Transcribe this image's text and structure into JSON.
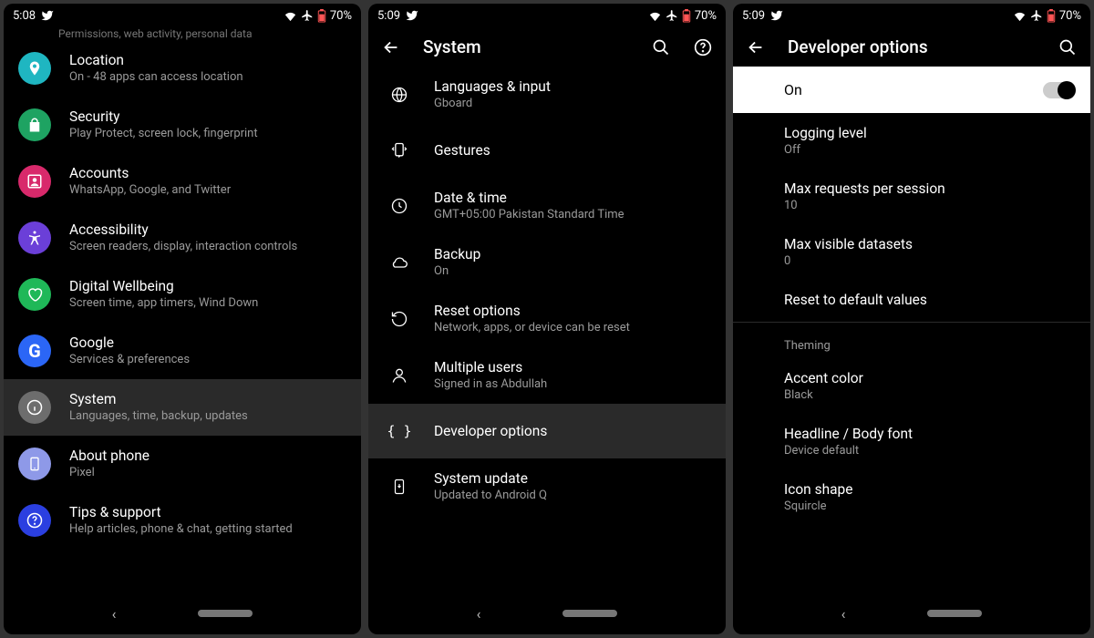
{
  "status": {
    "time1": "5:08",
    "time2": "5:09",
    "time3": "5:09",
    "battery": "70%"
  },
  "screen1": {
    "truncated_hint": "Permissions, web activity, personal data",
    "items": [
      {
        "title": "Location",
        "sub": "On - 48 apps can access location",
        "color": "#1fb6c1",
        "icon": "location"
      },
      {
        "title": "Security",
        "sub": "Play Protect, screen lock, fingerprint",
        "color": "#1ea362",
        "icon": "lock"
      },
      {
        "title": "Accounts",
        "sub": "WhatsApp, Google, and Twitter",
        "color": "#d8296b",
        "icon": "person-box"
      },
      {
        "title": "Accessibility",
        "sub": "Screen readers, display, interaction controls",
        "color": "#6b3fd8",
        "icon": "accessibility"
      },
      {
        "title": "Digital Wellbeing",
        "sub": "Screen time, app timers, Wind Down",
        "color": "#1fb858",
        "icon": "heart"
      },
      {
        "title": "Google",
        "sub": "Services & preferences",
        "color": "#2b66f6",
        "icon": "google"
      },
      {
        "title": "System",
        "sub": "Languages, time, backup, updates",
        "color": "#6d6d6d",
        "icon": "info",
        "selected": true
      },
      {
        "title": "About phone",
        "sub": "Pixel",
        "color": "#8e99e8",
        "icon": "phone"
      },
      {
        "title": "Tips & support",
        "sub": "Help articles, phone & chat, getting started",
        "color": "#2b3fe0",
        "icon": "help"
      }
    ]
  },
  "screen2": {
    "title": "System",
    "items": [
      {
        "title": "Languages & input",
        "sub": "Gboard",
        "icon": "globe"
      },
      {
        "title": "Gestures",
        "sub": "",
        "icon": "gesture"
      },
      {
        "title": "Date & time",
        "sub": "GMT+05:00 Pakistan Standard Time",
        "icon": "clock"
      },
      {
        "title": "Backup",
        "sub": "On",
        "icon": "cloud"
      },
      {
        "title": "Reset options",
        "sub": "Network, apps, or device can be reset",
        "icon": "reset"
      },
      {
        "title": "Multiple users",
        "sub": "Signed in as Abdullah",
        "icon": "person"
      },
      {
        "title": "Developer options",
        "sub": "",
        "icon": "braces",
        "selected": true
      },
      {
        "title": "System update",
        "sub": "Updated to Android Q",
        "icon": "update-phone"
      }
    ]
  },
  "screen3": {
    "title": "Developer options",
    "toggle_label": "On",
    "items": [
      {
        "title": "Logging level",
        "sub": "Off"
      },
      {
        "title": "Max requests per session",
        "sub": "10"
      },
      {
        "title": "Max visible datasets",
        "sub": "0"
      },
      {
        "title": "Reset to default values",
        "sub": ""
      }
    ],
    "section": "Theming",
    "theming": [
      {
        "title": "Accent color",
        "sub": "Black"
      },
      {
        "title": "Headline / Body font",
        "sub": "Device default"
      },
      {
        "title": "Icon shape",
        "sub": "Squircle"
      }
    ]
  }
}
